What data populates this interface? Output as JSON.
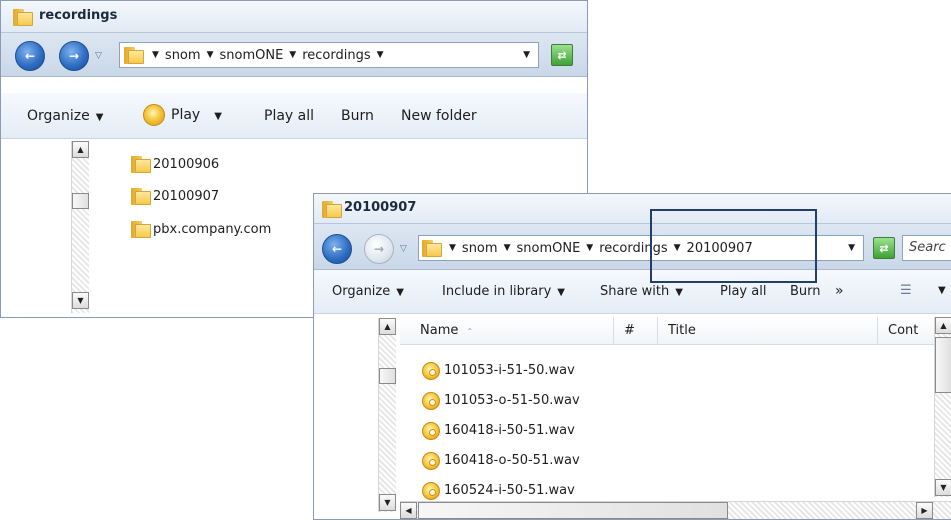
{
  "back_window": {
    "title": "recordings",
    "address": {
      "crumbs": [
        "snom",
        "snomONE",
        "recordings"
      ]
    },
    "toolbar": {
      "organize": "Organize",
      "play": "Play",
      "play_all": "Play all",
      "burn": "Burn",
      "new_folder": "New folder"
    },
    "items": [
      "20100906",
      "20100907",
      "pbx.company.com"
    ]
  },
  "front_window": {
    "title": "20100907",
    "address": {
      "crumbs": [
        "snom",
        "snomONE",
        "recordings",
        "20100907"
      ]
    },
    "search_placeholder": "Searc",
    "toolbar": {
      "organize": "Organize",
      "include_in_library": "Include in library",
      "share_with": "Share with",
      "play_all": "Play all",
      "burn": "Burn",
      "more": "»"
    },
    "columns": [
      "Name",
      "#",
      "Title",
      "Cont"
    ],
    "files": [
      "101053-i-51-50.wav",
      "101053-o-51-50.wav",
      "160418-i-50-51.wav",
      "160418-o-50-51.wav",
      "160524-i-50-51.wav"
    ]
  },
  "colors": {
    "highlight_border": "#243e6b",
    "title_bar": "#e1eaf5"
  }
}
